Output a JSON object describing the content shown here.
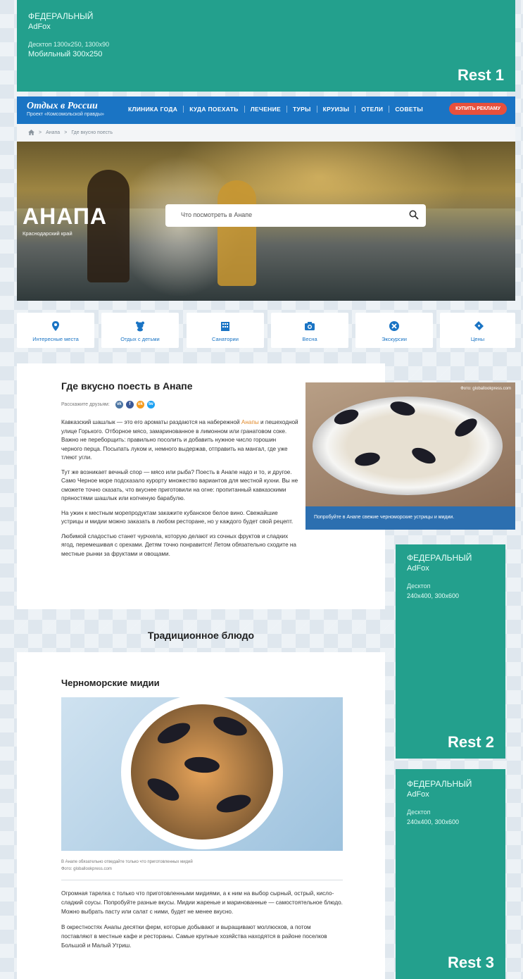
{
  "colors": {
    "brand": "#1a74c4",
    "ad": "#23a08d",
    "accent": "#e7503c"
  },
  "ads": {
    "top": {
      "line1": "ФЕДЕРАЛЬНЫЙ",
      "line2": "AdFox",
      "line3": "Десктоп 1300x250, 1300x90",
      "line4": "Мобильный 300x250",
      "rest": "Rest 1"
    },
    "right1": {
      "line1": "ФЕДЕРАЛЬНЫЙ",
      "line2": "AdFox",
      "line3": "Десктоп",
      "line4": "240x400, 300x600",
      "rest": "Rest 2"
    },
    "right2": {
      "line1": "ФЕДЕРАЛЬНЫЙ",
      "line2": "AdFox",
      "line3": "Десктоп",
      "line4": "240x400, 300x600",
      "rest": "Rest 3"
    }
  },
  "header": {
    "logo_title": "Отдых в России",
    "logo_sub": "Проект «Комсомольской правды»",
    "menu": [
      "КЛИНИКА ГОДА",
      "КУДА ПОЕХАТЬ",
      "ЛЕЧЕНИЕ",
      "ТУРЫ",
      "КРУИЗЫ",
      "ОТЕЛИ",
      "СОВЕТЫ"
    ],
    "buy_label": "КУПИТЬ РЕКЛАМУ"
  },
  "breadcrumb": {
    "items": [
      "Анапа",
      "Где вкусно поесть"
    ]
  },
  "hero": {
    "title": "АНАПА",
    "subtitle": "Краснодарский край",
    "search_placeholder": "Что посмотреть в Анапе"
  },
  "categories": [
    {
      "label": "Интересные места",
      "icon": "map-marker-icon"
    },
    {
      "label": "Отдых с детьми",
      "icon": "teddy-bear-icon"
    },
    {
      "label": "Санатории",
      "icon": "building-icon"
    },
    {
      "label": "Весна",
      "icon": "camera-icon"
    },
    {
      "label": "Экскурсии",
      "icon": "close-circle-icon"
    },
    {
      "label": "Цены",
      "icon": "ticket-icon"
    }
  ],
  "article": {
    "title": "Где вкусно поесть в Анапе",
    "share_label": "Расскажите друзьям:",
    "share_buttons": [
      "vk",
      "f",
      "ok",
      "tw"
    ],
    "p1_before": "Кавказский шашлык — это его ароматы раздаются на набережной ",
    "p1_link": "Анапы",
    "p1_after": " и пешеходной улице Горького. Отборное мясо, замаринованное в лимонном или гранатовом соке. Важно не переборщить: правильно посолить и добавить нужное число горошин черного перца. Посыпать луком и, немного выдержав, отправить на мангал, где уже тлеют угли.",
    "p2": "Тут же возникает вечный спор — мясо или рыба? Поесть в Анапе надо и то, и другое. Само Черное море подсказало курорту множество вариантов для местной кухни. Вы не сможете точно сказать, что вкуснее приготовили на огне: пропитанный кавказскими пряностями шашлык или копченую барабулю.",
    "p3": "На ужин к местным морепродуктам закажите кубанское белое вино. Свежайшие устрицы и мидии можно заказать в любом ресторане, но у каждого будет свой рецепт.",
    "p4": "Любимой сладостью станет чурчхела, которую делают из сочных фруктов и сладких ягод, перемешивая с орехами. Детям точно понравится! Летом обязательно сходите на местные рынки за фруктами и овощами.",
    "photo_credit": "Фото: globallookpress.com",
    "photo_caption": "Попробуйте в Анапе свежие черноморские устрицы и мидии."
  },
  "section": {
    "title": "Традиционное блюдо"
  },
  "dish": {
    "title": "Черноморские мидии",
    "caption": "В Анапе обязательно отведайте только что приготовленных мидий",
    "credit": "Фото: globallookpress.com",
    "p1": "Огромная тарелка с только что приготовленными мидиями, а к ним на выбор сырный, острый, кисло-сладкий соусы. Попробуйте разные вкусы. Мидии жареные и маринованные — самостоятельное блюдо. Можно выбрать пасту или салат с ними, будет не менее вкусно.",
    "p2": "В окрестностях Анапы десятки ферм, которые добывают и выращивают моллюсков, а потом поставляют в местные кафе и рестораны. Самые крупные хозяйства находятся в районе поселков Большой и Малый Утриш."
  }
}
